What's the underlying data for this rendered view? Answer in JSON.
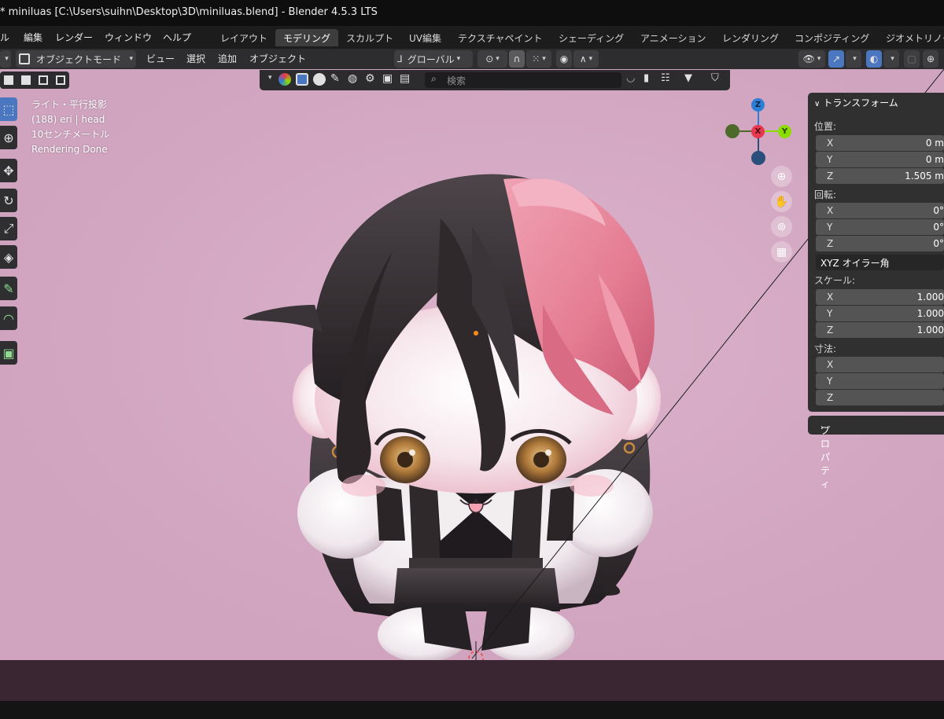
{
  "window": {
    "title": "* miniluas [C:\\Users\\suihn\\Desktop\\3D\\miniluas.blend] - Blender 4.5.3 LTS"
  },
  "menubar": {
    "menus": [
      "ル",
      "編集",
      "レンダー",
      "ウィンドウ",
      "ヘルプ"
    ],
    "workspace_tabs": [
      {
        "label": "レイアウト",
        "active": false
      },
      {
        "label": "モデリング",
        "active": true
      },
      {
        "label": "スカルプト",
        "active": false
      },
      {
        "label": "UV編集",
        "active": false
      },
      {
        "label": "テクスチャペイント",
        "active": false
      },
      {
        "label": "シェーディング",
        "active": false
      },
      {
        "label": "アニメーション",
        "active": false
      },
      {
        "label": "レンダリング",
        "active": false
      },
      {
        "label": "コンポジティング",
        "active": false
      },
      {
        "label": "ジオメトリノー",
        "active": false
      }
    ]
  },
  "viewport_header": {
    "mode": "オブジェクトモード",
    "menus": [
      "ビュー",
      "選択",
      "追加",
      "オブジェクト"
    ],
    "transform_orientation": "グローバル"
  },
  "overlay_bar": {
    "search_placeholder": "検索"
  },
  "viewport_info": {
    "line1": "ライト・平行投影",
    "line2": "(188) eri | head",
    "line3": "10センチメートル",
    "line4": "Rendering Done"
  },
  "gizmo": {
    "axes": {
      "z": "Z",
      "x": "X",
      "y": "Y"
    },
    "colors": {
      "x": "#e8384f",
      "y": "#8bdc00",
      "z": "#2d7fd6"
    }
  },
  "n_panel": {
    "transform_header": "トランスフォーム",
    "location_label": "位置:",
    "location": [
      {
        "axis": "X",
        "value": "0 m"
      },
      {
        "axis": "Y",
        "value": "0 m"
      },
      {
        "axis": "Z",
        "value": "1.505 m"
      }
    ],
    "rotation_label": "回転:",
    "rotation": [
      {
        "axis": "X",
        "value": "0°"
      },
      {
        "axis": "Y",
        "value": "0°"
      },
      {
        "axis": "Z",
        "value": "0°"
      }
    ],
    "rotation_mode": "XYZ オイラー角",
    "scale_label": "スケール:",
    "scale": [
      {
        "axis": "X",
        "value": "1.000"
      },
      {
        "axis": "Y",
        "value": "1.000"
      },
      {
        "axis": "Z",
        "value": "1.000"
      }
    ],
    "dimensions_label": "寸法:",
    "dimensions": [
      {
        "axis": "X",
        "value": ""
      },
      {
        "axis": "Y",
        "value": ""
      },
      {
        "axis": "Z",
        "value": ""
      }
    ],
    "properties_header": "プロパティ"
  },
  "colors": {
    "viewport_bg": "#d8abc6",
    "active_tool": "#4b77c0",
    "hair_pink": "#e57d93",
    "hair_dark": "#3a3438"
  }
}
